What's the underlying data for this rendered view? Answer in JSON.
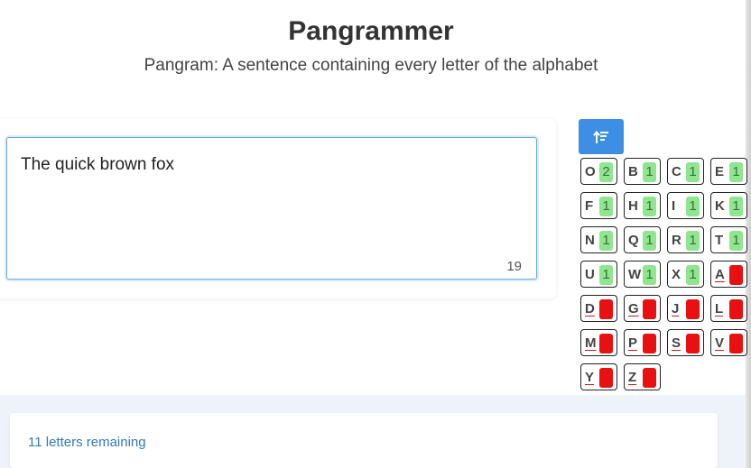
{
  "header": {
    "title": "Pangrammer",
    "subtitle": "Pangram: A sentence containing every letter of the alphabet"
  },
  "editor": {
    "text": "The quick brown fox",
    "char_count": "19"
  },
  "sort_button": {
    "icon": "sort-ascending-icon"
  },
  "letters": [
    {
      "letter": "O",
      "count": "2",
      "present": true
    },
    {
      "letter": "B",
      "count": "1",
      "present": true
    },
    {
      "letter": "C",
      "count": "1",
      "present": true
    },
    {
      "letter": "E",
      "count": "1",
      "present": true
    },
    {
      "letter": "F",
      "count": "1",
      "present": true
    },
    {
      "letter": "H",
      "count": "1",
      "present": true
    },
    {
      "letter": "I",
      "count": "1",
      "present": true
    },
    {
      "letter": "K",
      "count": "1",
      "present": true
    },
    {
      "letter": "N",
      "count": "1",
      "present": true
    },
    {
      "letter": "Q",
      "count": "1",
      "present": true
    },
    {
      "letter": "R",
      "count": "1",
      "present": true
    },
    {
      "letter": "T",
      "count": "1",
      "present": true
    },
    {
      "letter": "U",
      "count": "1",
      "present": true
    },
    {
      "letter": "W",
      "count": "1",
      "present": true
    },
    {
      "letter": "X",
      "count": "1",
      "present": true
    },
    {
      "letter": "A",
      "count": "0",
      "present": false
    },
    {
      "letter": "D",
      "count": "0",
      "present": false
    },
    {
      "letter": "G",
      "count": "0",
      "present": false
    },
    {
      "letter": "J",
      "count": "0",
      "present": false
    },
    {
      "letter": "L",
      "count": "0",
      "present": false
    },
    {
      "letter": "M",
      "count": "0",
      "present": false
    },
    {
      "letter": "P",
      "count": "0",
      "present": false
    },
    {
      "letter": "S",
      "count": "0",
      "present": false
    },
    {
      "letter": "V",
      "count": "0",
      "present": false
    },
    {
      "letter": "Y",
      "count": "0",
      "present": false
    },
    {
      "letter": "Z",
      "count": "0",
      "present": false
    }
  ],
  "status": {
    "text": "11 letters remaining"
  },
  "colors": {
    "accent": "#3d8fe6",
    "present": "#8fe68f",
    "missing": "#e81010",
    "status_text": "#2f7bbf"
  }
}
